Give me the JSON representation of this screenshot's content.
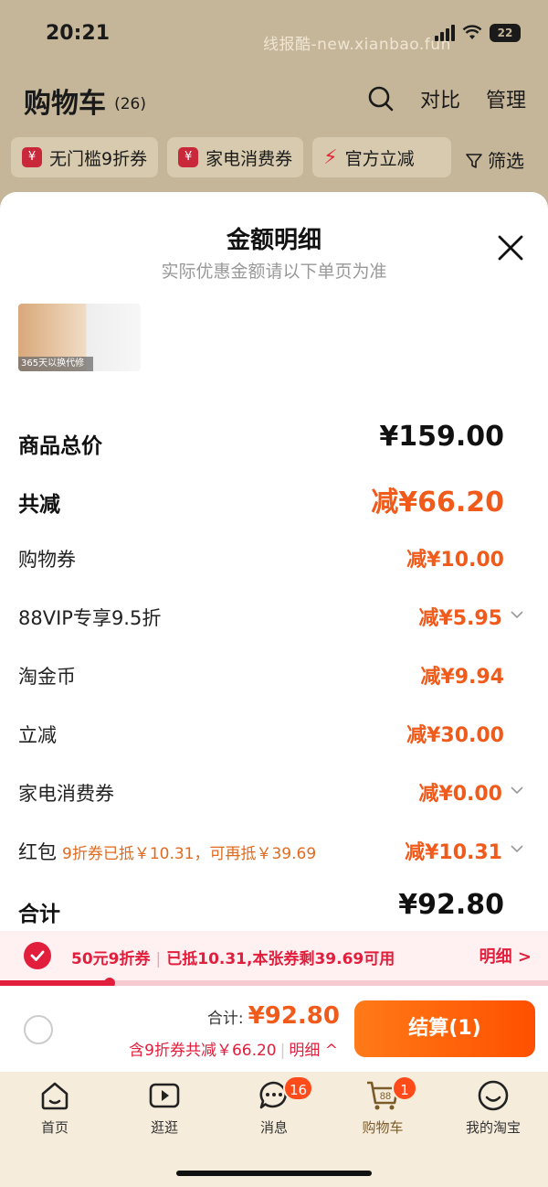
{
  "status": {
    "time": "20:21",
    "battery": "22",
    "watermark": "线报酷-new.xianbao.fun"
  },
  "cart": {
    "title": "购物车",
    "count": "(26)",
    "compare_label": "对比",
    "manage_label": "管理"
  },
  "coupon_chips": [
    {
      "label": "无门槛9折券",
      "icon": "coupon-icon"
    },
    {
      "label": "家电消费券",
      "icon": "coupon-icon"
    },
    {
      "label": "官方立减",
      "icon": "bolt-icon"
    }
  ],
  "filter_label": "筛选",
  "sheet": {
    "title": "金额明细",
    "subtitle": "实际优惠金额请以下单页为准",
    "thumb_badge": "365天以换代修"
  },
  "rows": [
    {
      "label": "商品总价",
      "value": "¥159.00"
    },
    {
      "label": "共减",
      "value": "减¥66.20"
    },
    {
      "label": "购物券",
      "value": "减¥10.00"
    },
    {
      "label": "88VIP专享9.5折",
      "value": "减¥5.95"
    },
    {
      "label": "淘金币",
      "value": "减¥9.94"
    },
    {
      "label": "立减",
      "value": "减¥30.00"
    },
    {
      "label": "家电消费券",
      "value": "减¥0.00"
    },
    {
      "label": "红包",
      "note": "9折券已抵￥10.31，可再抵￥39.69",
      "value": "减¥10.31"
    },
    {
      "label": "合计",
      "value": "¥92.80"
    }
  ],
  "banner": {
    "coupon_name": "50元9折券",
    "info": "已抵10.31,本张券剩39.69可用",
    "detail_label": "明细 >",
    "progress": 0.2
  },
  "checkout": {
    "total_label": "合计:",
    "total_amount": "¥92.80",
    "saving_text": "含9折券共减￥66.20",
    "detail_label": "明细 ^",
    "pay_label": "结算(1)"
  },
  "tabs": [
    {
      "label": "首页",
      "icon": "home-icon"
    },
    {
      "label": "逛逛",
      "icon": "play-icon"
    },
    {
      "label": "消息",
      "icon": "message-icon",
      "badge": "16"
    },
    {
      "label": "购物车",
      "icon": "cart-icon",
      "badge": "1",
      "cart_count": "88"
    },
    {
      "label": "我的淘宝",
      "icon": "smile-icon"
    }
  ],
  "colors": {
    "accent": "#f05a1a",
    "coupon_red": "#e11e3c",
    "pay_orange": "#ff5000"
  }
}
